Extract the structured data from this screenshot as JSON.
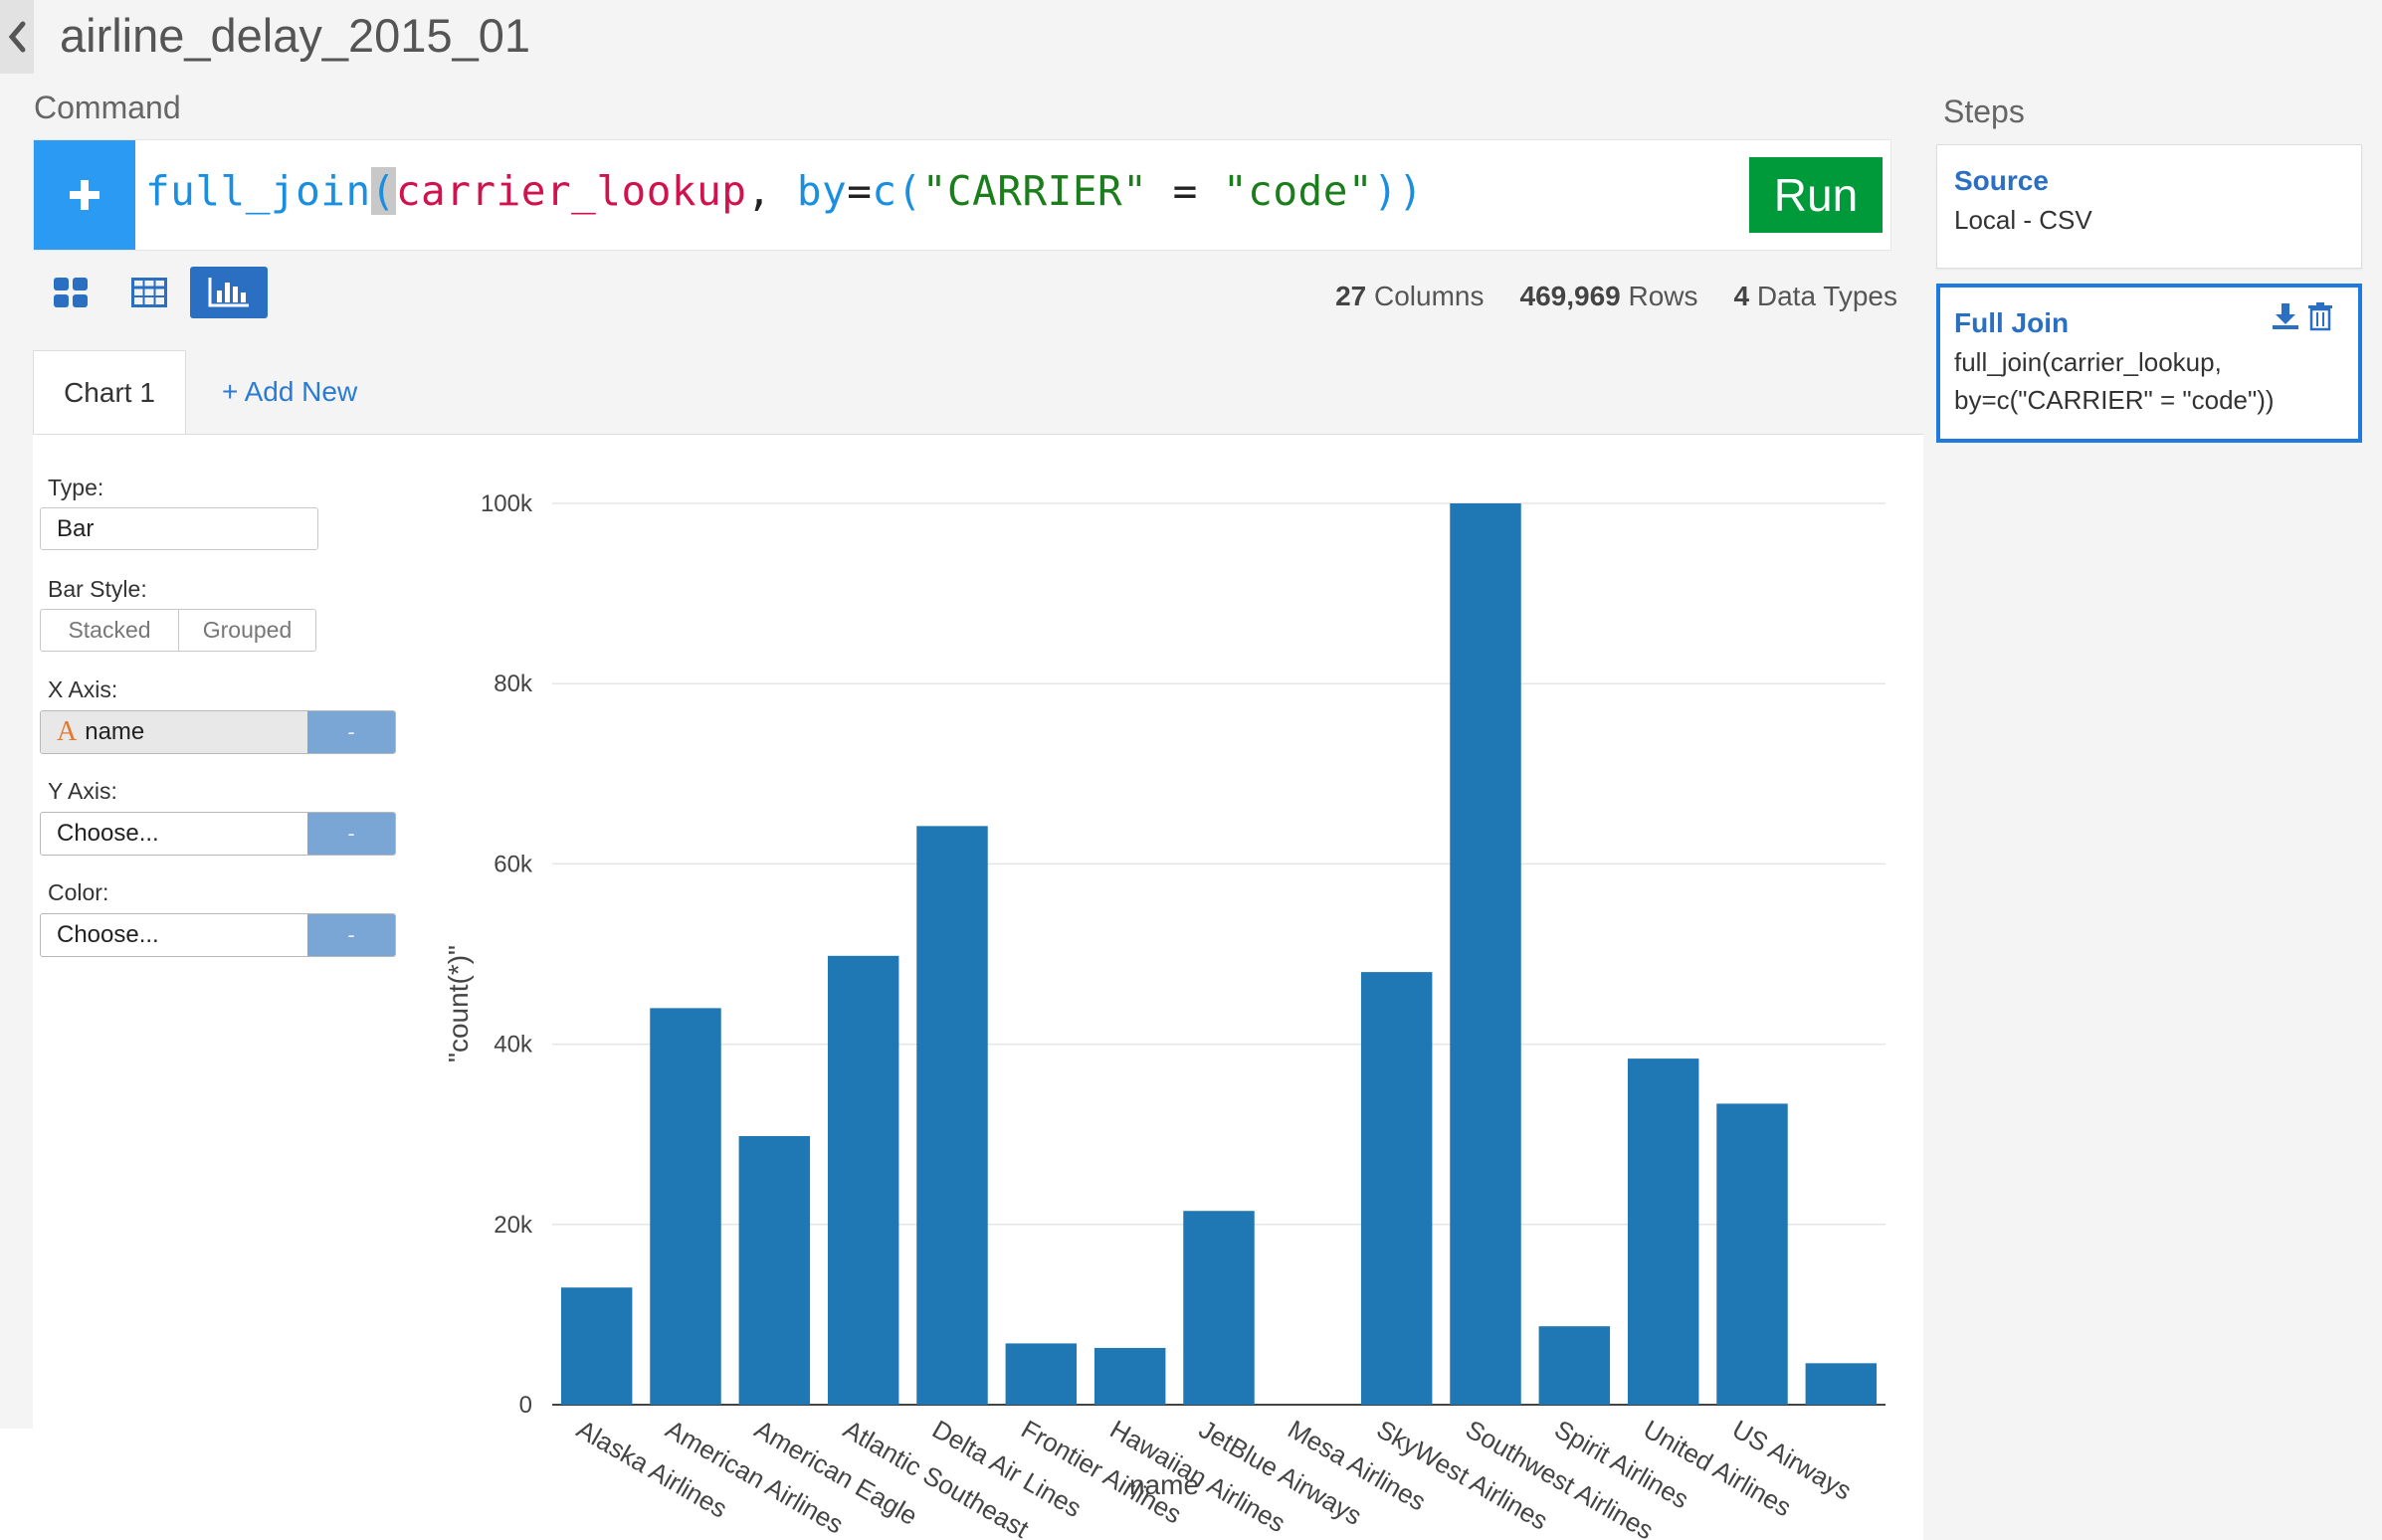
{
  "window": {
    "title": "airline_delay_2015_01"
  },
  "command": {
    "label": "Command",
    "function": "full_join",
    "open_paren": "(",
    "arg": "carrier_lookup",
    "sep": ", ",
    "by_kw": "by",
    "eq": "=",
    "c_fn": "c",
    "inner_open": "(",
    "str1": "\"CARRIER\"",
    "op": " = ",
    "str2": "\"code\"",
    "close": "))",
    "run_label": "Run",
    "add_icon": "plus-icon"
  },
  "view_modes": [
    {
      "name": "summary-view",
      "icon": "grid-icon",
      "active": false
    },
    {
      "name": "table-view",
      "icon": "table-icon",
      "active": false
    },
    {
      "name": "chart-view",
      "icon": "bar-chart-icon",
      "active": true
    }
  ],
  "stats": {
    "columns_value": "27",
    "columns_label": " Columns",
    "rows_value": "469,969",
    "rows_label": " Rows",
    "types_value": "4",
    "types_label": " Data Types"
  },
  "tabs": {
    "chart1": "Chart 1",
    "add_new": "+ Add New"
  },
  "chart_settings": {
    "type_label": "Type:",
    "type_value": "Bar",
    "bar_style_label": "Bar Style:",
    "stacked": "Stacked",
    "grouped": "Grouped",
    "x_axis_label": "X Axis:",
    "x_axis_type_glyph": "A",
    "x_axis_value": "name",
    "x_axis_btn": "-",
    "y_axis_label": "Y Axis:",
    "y_axis_value": "Choose...",
    "y_axis_btn": "-",
    "color_label": "Color:",
    "color_value": "Choose...",
    "color_btn": "-"
  },
  "chart_data": {
    "type": "bar",
    "xlabel": "name",
    "ylabel": "\"count(*)\"",
    "ylim": [
      0,
      100000
    ],
    "y_ticks": [
      0,
      20000,
      40000,
      60000,
      80000,
      100000
    ],
    "y_tick_labels": [
      "0",
      "20k",
      "40k",
      "60k",
      "80k",
      "100k"
    ],
    "categories": [
      "Alaska Airlines",
      "American Airlines",
      "American Eagle",
      "Atlantic Southeast",
      "Delta Air Lines",
      "Frontier Airlines",
      "Hawaiian Airlines",
      "JetBlue Airways",
      "Mesa Airlines",
      "SkyWest Airlines",
      "Southwest Airlines",
      "Spirit Airlines",
      "United Airlines",
      "US Airways",
      ""
    ],
    "values": [
      13000,
      44000,
      29800,
      49800,
      64200,
      6800,
      6300,
      21500,
      0,
      48000,
      100000,
      8700,
      38400,
      33400,
      4600
    ],
    "color": "#1f77b4",
    "grid": true
  },
  "steps": {
    "label": "Steps",
    "items": [
      {
        "title": "Source",
        "desc": "Local - CSV"
      },
      {
        "title": "Full Join",
        "desc_line1": "full_join(carrier_lookup,",
        "desc_line2": "by=c(\"CARRIER\" = \"code\"))"
      }
    ],
    "download_icon": "download-icon",
    "delete_icon": "trash-icon"
  }
}
